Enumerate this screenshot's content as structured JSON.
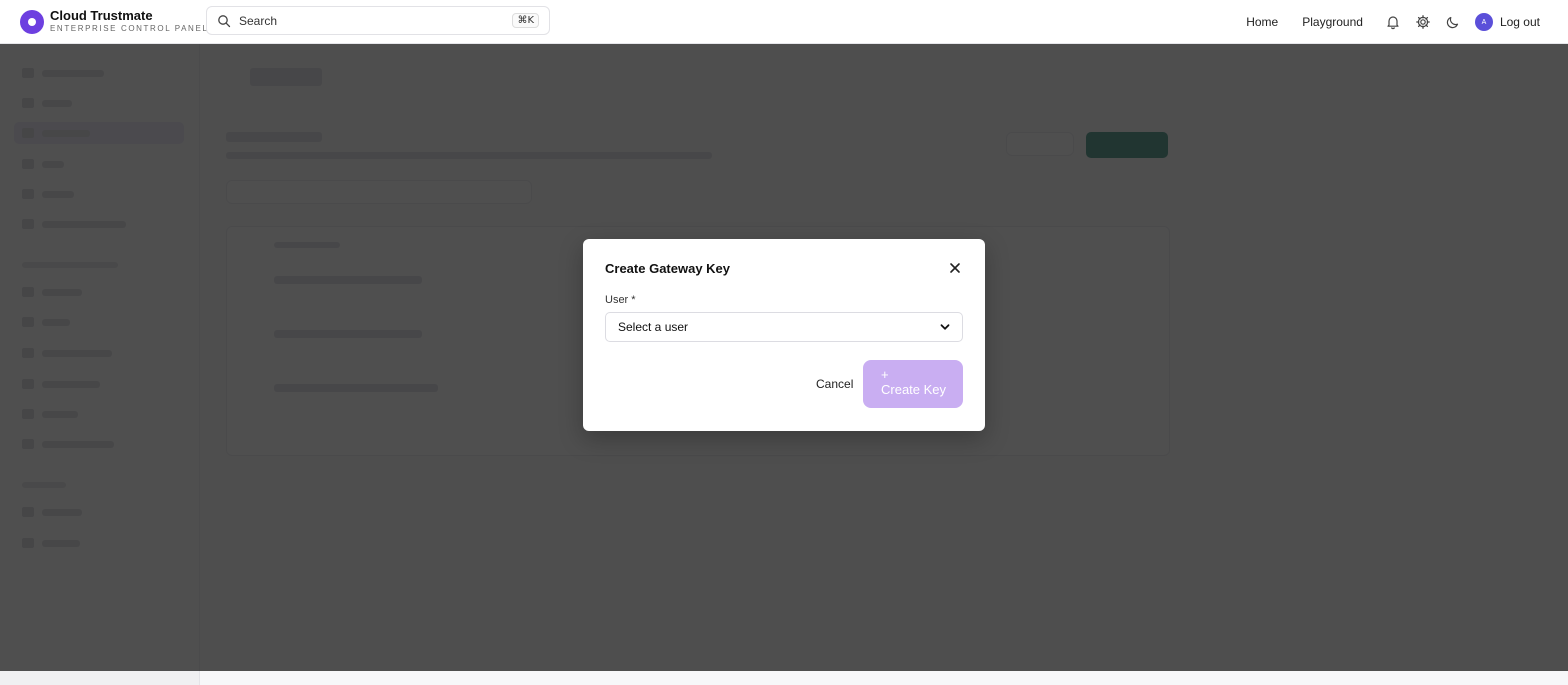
{
  "header": {
    "brand_name": "Cloud Trustmate",
    "brand_subtitle": "ENTERPRISE CONTROL PANEL",
    "search_placeholder": "Search",
    "search_shortcut": "⌘K",
    "nav": [
      "Home",
      "Playground"
    ],
    "avatar_initial": "A",
    "logout_label": "Log out"
  },
  "modal": {
    "title": "Create Gateway Key",
    "user_label": "User *",
    "user_select_value": "Select a user",
    "cancel_label": "Cancel",
    "create_plus": "+",
    "create_label": "Create Key"
  },
  "colors": {
    "brand": "#6d3fe0",
    "create_button_disabled": "#c9aef2",
    "overlay": "#1e1e1e"
  },
  "icons": {
    "search": "search-icon",
    "bell": "bell-icon",
    "settings": "gear-icon",
    "theme": "moon-icon",
    "close": "close-icon",
    "select": "chevron-down-icon"
  }
}
